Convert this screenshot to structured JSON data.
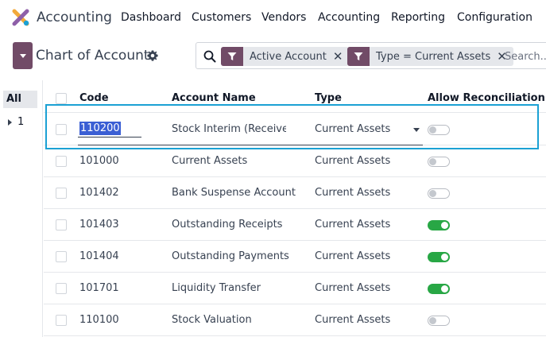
{
  "app": {
    "name": "Accounting"
  },
  "nav": {
    "items": [
      "Dashboard",
      "Customers",
      "Vendors",
      "Accounting",
      "Reporting",
      "Configuration"
    ]
  },
  "control": {
    "title": "Chart of Accounts",
    "facets": [
      {
        "label": "Active Account",
        "icon": "filter-icon"
      },
      {
        "label": "Type = Current Assets",
        "icon": "filter-icon"
      }
    ],
    "search_placeholder": "Search..."
  },
  "sidepanel": {
    "all_label": "All",
    "group_label": "1"
  },
  "table": {
    "headers": {
      "code": "Code",
      "name": "Account Name",
      "type": "Type",
      "reconcile": "Allow Reconciliation"
    },
    "rows": [
      {
        "code": "110200",
        "name": "Stock Interim (Received)",
        "type": "Current Assets",
        "reconcile": false,
        "editing": true
      },
      {
        "code": "101000",
        "name": "Current Assets",
        "type": "Current Assets",
        "reconcile": false
      },
      {
        "code": "101402",
        "name": "Bank Suspense Account",
        "type": "Current Assets",
        "reconcile": false
      },
      {
        "code": "101403",
        "name": "Outstanding Receipts",
        "type": "Current Assets",
        "reconcile": true
      },
      {
        "code": "101404",
        "name": "Outstanding Payments",
        "type": "Current Assets",
        "reconcile": true
      },
      {
        "code": "101701",
        "name": "Liquidity Transfer",
        "type": "Current Assets",
        "reconcile": true
      },
      {
        "code": "110100",
        "name": "Stock Valuation",
        "type": "Current Assets",
        "reconcile": false
      }
    ]
  },
  "colors": {
    "brand": "#714B67",
    "toggle_on": "#28a745",
    "highlight": "#1ba1d4"
  }
}
